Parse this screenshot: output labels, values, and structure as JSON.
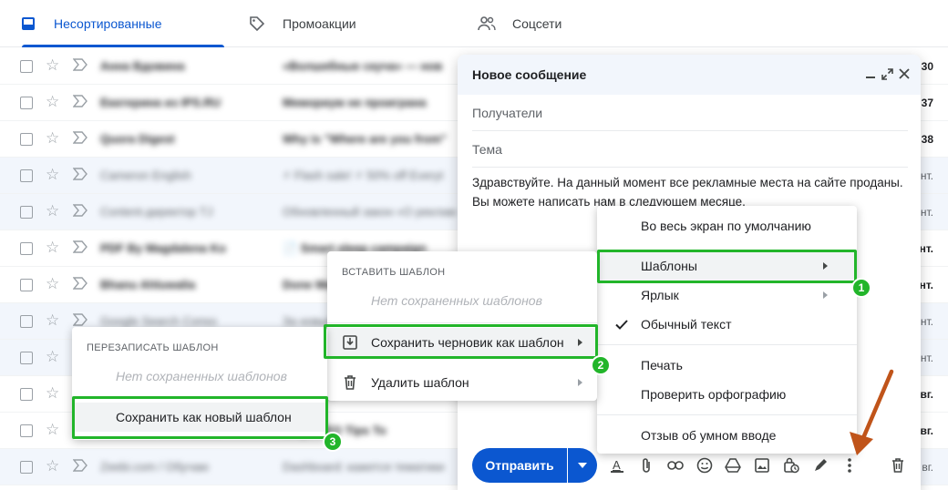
{
  "tabs": [
    {
      "label": "Несортированные",
      "icon": "inbox-icon",
      "active": true
    },
    {
      "label": "Промоакции",
      "icon": "tag-icon",
      "active": false
    },
    {
      "label": "Соцсети",
      "icon": "people-icon",
      "active": false
    }
  ],
  "emails": [
    {
      "sender": "Анна Вдовина",
      "subject": "«Волшебные скуча» — нов",
      "date": "30",
      "read": false
    },
    {
      "sender": "Екатерина из IPS.RU",
      "subject": "Мемориум не проиграна",
      "date": "37",
      "read": false
    },
    {
      "sender": "Quora Digest",
      "subject": "Why is \"Where are you from\"",
      "date": "38",
      "read": false
    },
    {
      "sender": "Cameron English",
      "subject": "⚡ Flash sale! ⚡ 50% off Everyt",
      "date": "нт.",
      "read": true
    },
    {
      "sender": "Content-директор TJ",
      "subject": "Обновленный закон «О рекламе»",
      "date": "нт.",
      "read": true
    },
    {
      "sender": "PDF By Magdalena Ko",
      "subject": "📄 Smart sleep campaign",
      "date": "нт.",
      "read": false
    },
    {
      "sender": "Bhanu Ahluwalia",
      "subject": "Done Me",
      "date": "нт.",
      "read": false
    },
    {
      "sender": "Google Search Conso",
      "subject": "За новые",
      "date": "нт.",
      "read": true
    },
    {
      "sender": "Ya.Services",
      "subject": "Уведомление",
      "date": "нт.",
      "read": true
    },
    {
      "sender": "Ubersuggest",
      "subject": "Your plan",
      "date": "вг.",
      "read": false
    },
    {
      "sender": "Backlinko Brian Dean",
      "subject": "mage SEO Tips To",
      "date": "вг.",
      "read": false
    },
    {
      "sender": "Zeebi.com / Обучаю",
      "subject": "Dashboard: кажется тематики",
      "date": "вг.",
      "read": true
    }
  ],
  "compose": {
    "title": "Новое сообщение",
    "to_placeholder": "Получатели",
    "subject_placeholder": "Тема",
    "body": "Здравствуйте. На данный момент все рекламные места на сайте проданы. Вы можете написать нам в следующем месяце.",
    "send_label": "Отправить"
  },
  "more_menu": {
    "items": [
      {
        "label": "Во весь экран по умолчанию"
      },
      {
        "label": "Шаблоны",
        "submenu": true
      },
      {
        "label": "Ярлык",
        "submenu": true
      },
      {
        "label": "Обычный текст",
        "checked": true
      },
      {
        "label": "Печать"
      },
      {
        "label": "Проверить орфографию"
      },
      {
        "label": "Отзыв об умном вводе"
      }
    ]
  },
  "templates_menu": {
    "header": "ВСТАВИТЬ ШАБЛОН",
    "empty": "Нет сохраненных шаблонов",
    "save_draft": "Сохранить черновик как шаблон",
    "delete": "Удалить шаблон"
  },
  "overwrite_menu": {
    "header": "ПЕРЕЗАПИСАТЬ ШАБЛОН",
    "empty": "Нет сохраненных шаблонов",
    "save_new": "Сохранить как новый шаблон"
  },
  "badges": [
    "1",
    "2",
    "3"
  ],
  "colors": {
    "accent": "#0b57d0",
    "highlight": "#22b52a",
    "arrow": "#c0541a",
    "read_row": "#f2f6fc"
  }
}
